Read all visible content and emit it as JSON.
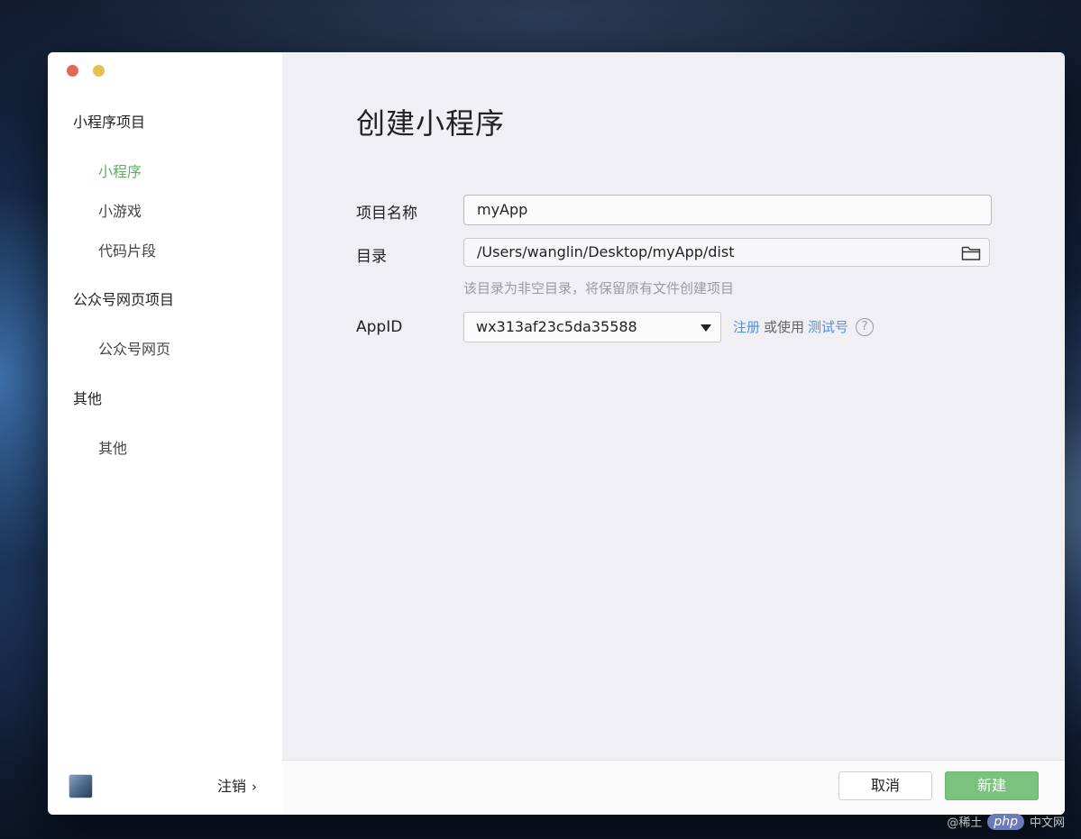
{
  "sidebar": {
    "groups": [
      {
        "title": "小程序项目",
        "items": [
          "小程序",
          "小游戏",
          "代码片段"
        ]
      },
      {
        "title": "公众号网页项目",
        "items": [
          "公众号网页"
        ]
      },
      {
        "title": "其他",
        "items": [
          "其他"
        ]
      }
    ],
    "active_item": "小程序",
    "logout_label": "注销"
  },
  "main": {
    "title": "创建小程序",
    "project_name": {
      "label": "项目名称",
      "value": "myApp"
    },
    "directory": {
      "label": "目录",
      "value": "/Users/wanglin/Desktop/myApp/dist",
      "hint": "该目录为非空目录，将保留原有文件创建项目"
    },
    "appid": {
      "label": "AppID",
      "value": "wx313af23c5da35588",
      "register_link": "注册",
      "or_use": "或使用",
      "test_link": "测试号",
      "help": "?"
    }
  },
  "footer": {
    "cancel_label": "取消",
    "create_label": "新建"
  },
  "watermark": {
    "left_text": "@稀土",
    "badge": "php",
    "right_text": "中文网"
  },
  "colors": {
    "accent_green": "#59b25f",
    "button_green": "#7bc27f",
    "link_blue": "#5b8ed0"
  }
}
